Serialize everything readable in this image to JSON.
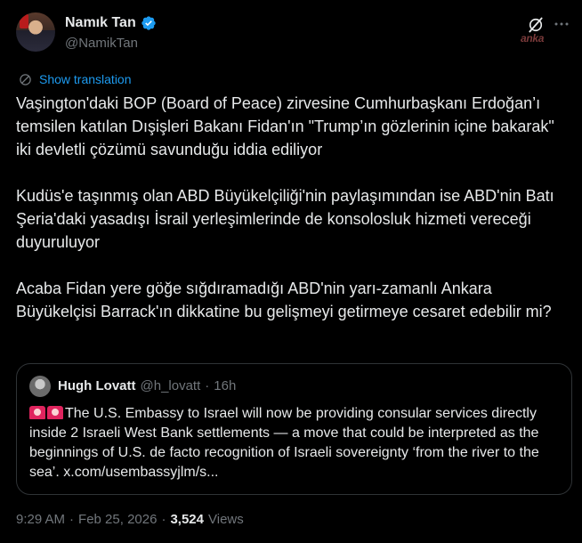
{
  "author": {
    "name": "Namık Tan",
    "handle": "@NamikTan"
  },
  "watermark": "anka",
  "translate": {
    "label": "Show translation"
  },
  "tweet": {
    "paragraphs": [
      "Vaşington'daki BOP (Board of Peace) zirvesine Cumhurbaşkanı Erdoğan’ı temsilen katılan Dışişleri Bakanı Fidan'ın \"Trump’ın gözlerinin içine bakarak\" iki devletli çözümü savunduğu iddia ediliyor",
      "Kudüs'e taşınmış olan ABD Büyükelçiliği'nin paylaşımından ise ABD'nin Batı Şeria'daki yasadışı İsrail yerleşimlerinde de konsolosluk hizmeti vereceği duyuruluyor",
      "Acaba Fidan yere göğe sığdıramadığı ABD'nin yarı-zamanlı Ankara Büyükelçisi Barrack'ın dikkatine bu gelişmeyi getirmeye cesaret edebilir mi?"
    ]
  },
  "quote": {
    "name": "Hugh Lovatt",
    "handle": "@h_lovatt",
    "separator": "·",
    "time": "16h",
    "text": "The U.S. Embassy to Israel will now be providing consular services directly inside 2 Israeli West Bank settlements — a move that could be interpreted as the beginnings of U.S. de facto recognition of Israeli sovereignty ‘from the river to the sea’. x.com/usembassyjlm/s..."
  },
  "meta": {
    "time": "9:29 AM",
    "sep1": "·",
    "date": "Feb 25, 2026",
    "sep2": "·",
    "views_count": "3,524",
    "views_label": "Views"
  },
  "colors": {
    "background": "#000000",
    "text": "#e7e9ea",
    "secondary": "#71767b",
    "link": "#1d9bf0",
    "border": "#2f3336",
    "verified": "#1d9bf0"
  },
  "icons": [
    "verified-badge-icon",
    "grok-icon",
    "more-icon",
    "globe-icon",
    "siren-icon"
  ]
}
